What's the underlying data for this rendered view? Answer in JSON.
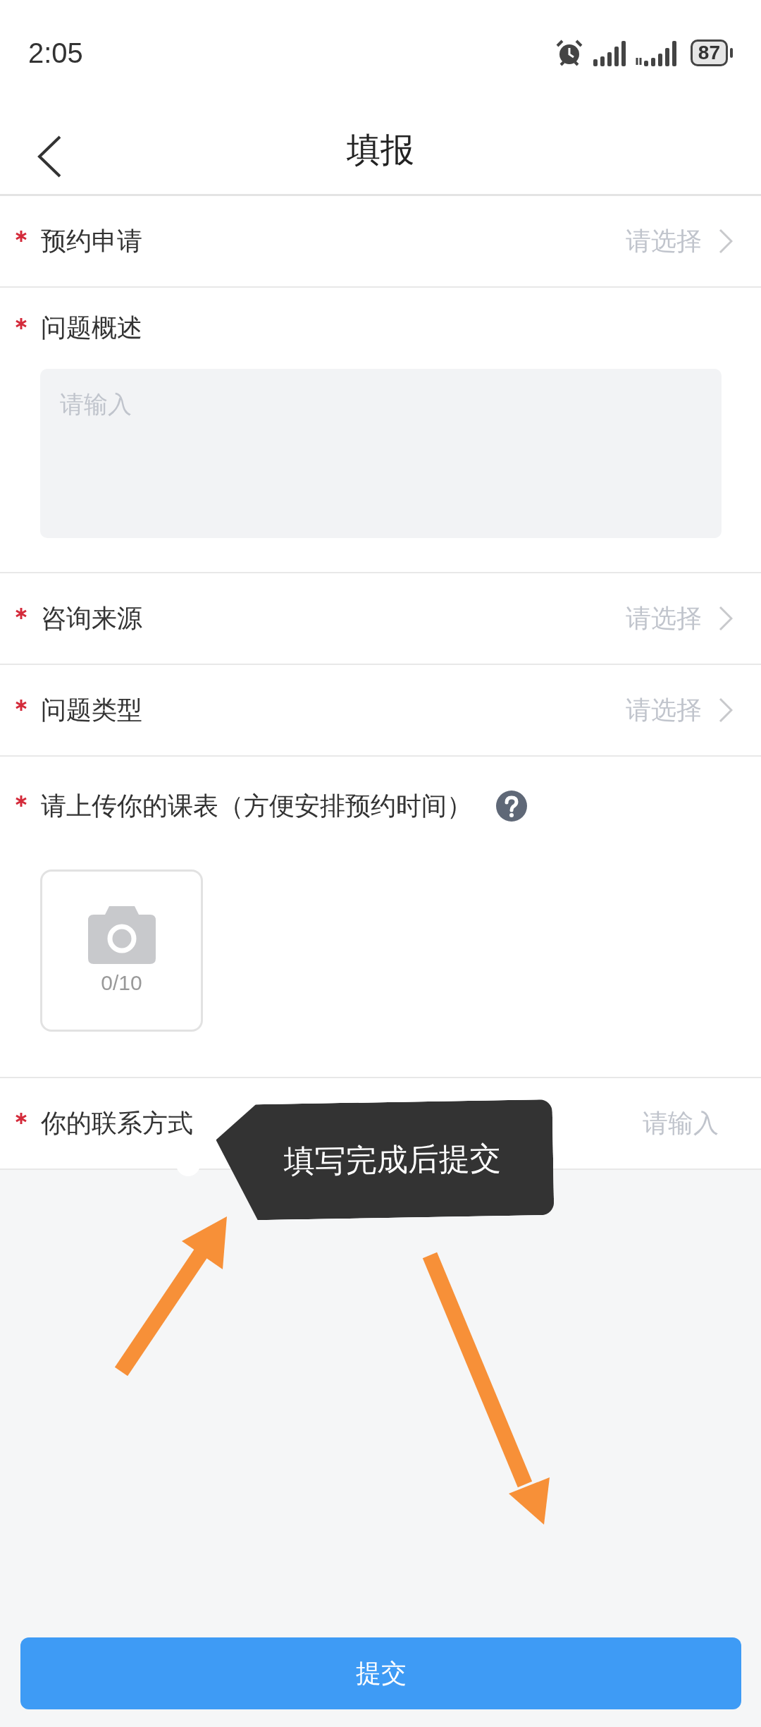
{
  "status_bar": {
    "time": "2:05",
    "battery": "87"
  },
  "nav": {
    "title": "填报"
  },
  "fields": [
    {
      "kind": "select",
      "label": "预约申请",
      "required": true,
      "placeholder": "请选择"
    },
    {
      "kind": "textarea",
      "label": "问题概述",
      "required": true,
      "placeholder": "请输入"
    },
    {
      "kind": "select",
      "label": "咨询来源",
      "required": true,
      "placeholder": "请选择"
    },
    {
      "kind": "select",
      "label": "问题类型",
      "required": true,
      "placeholder": "请选择"
    },
    {
      "kind": "upload",
      "label": "请上传你的课表（方便安排预约时间）",
      "required": true,
      "count": "0/10"
    },
    {
      "kind": "input",
      "label": "你的联系方式",
      "required": true,
      "placeholder": "请输入"
    }
  ],
  "tooltip": {
    "text": "填写完成后提交"
  },
  "submit_button": "提交"
}
